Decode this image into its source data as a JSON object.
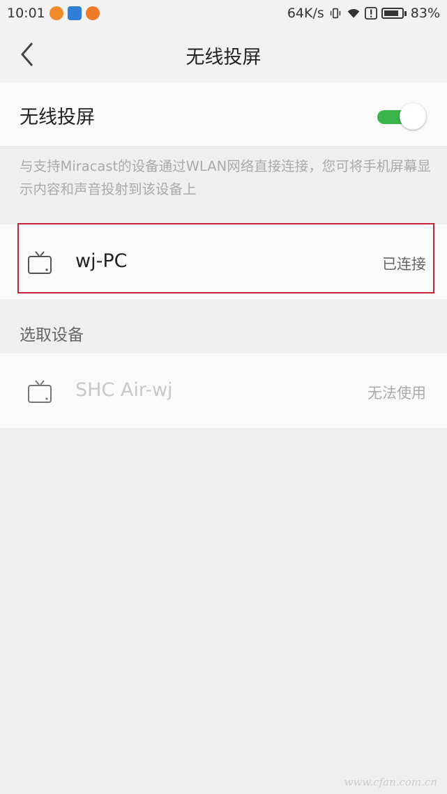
{
  "status_bar": {
    "time": "10:01",
    "net_speed": "64K/s",
    "battery_percent": "83%",
    "battery_level": 0.83
  },
  "nav": {
    "title": "无线投屏"
  },
  "toggle": {
    "label": "无线投屏",
    "enabled": true,
    "accent_color": "#3ab34a"
  },
  "description": "与支持Miracast的设备通过WLAN网络直接连接，您可将手机屏幕显示内容和声音投射到该设备上",
  "connected_devices": [
    {
      "name": "wj-PC",
      "status": "已连接",
      "icon": "tv-icon"
    }
  ],
  "available_section": {
    "header": "选取设备",
    "devices": [
      {
        "name": "SHC Air-wj",
        "status": "无法使用",
        "icon": "tv-icon"
      }
    ]
  },
  "annotation": {
    "highlight_color": "#c8233a"
  },
  "watermark": "www.cfan.com.cn"
}
